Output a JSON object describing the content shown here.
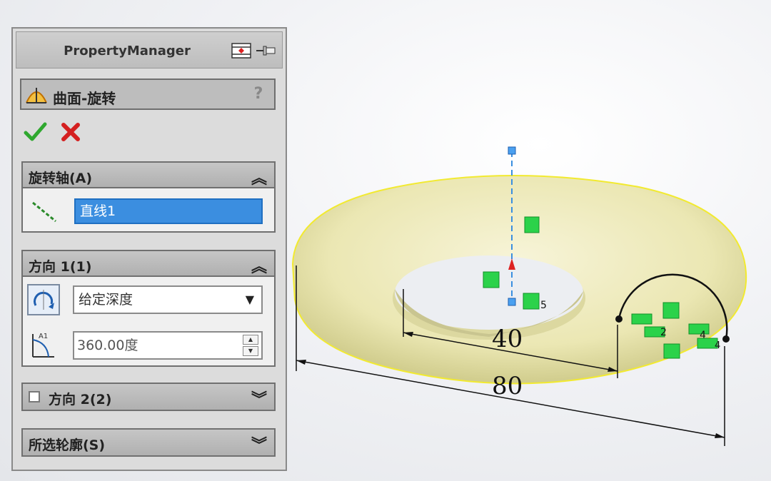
{
  "property_manager": {
    "title": "PropertyManager",
    "feature": {
      "icon": "revolve-surface-icon",
      "title": "曲面-旋转",
      "help": "?"
    },
    "actions": {
      "ok_icon": "checkmark-icon",
      "cancel_icon": "close-icon"
    },
    "sections": {
      "axis": {
        "title": "旋转轴(A)",
        "value": "直线1"
      },
      "direction1": {
        "title": "方向 1(1)",
        "end_condition": "给定深度",
        "angle": "360.00度",
        "angle_label": "A1"
      },
      "direction2": {
        "title": "方向 2(2)",
        "checked": false
      },
      "contours": {
        "title": "所选轮廓(S)"
      }
    }
  },
  "viewport": {
    "dimensions": [
      "40",
      "80"
    ],
    "relation_labels": [
      "5",
      "2",
      "4",
      "4"
    ]
  }
}
